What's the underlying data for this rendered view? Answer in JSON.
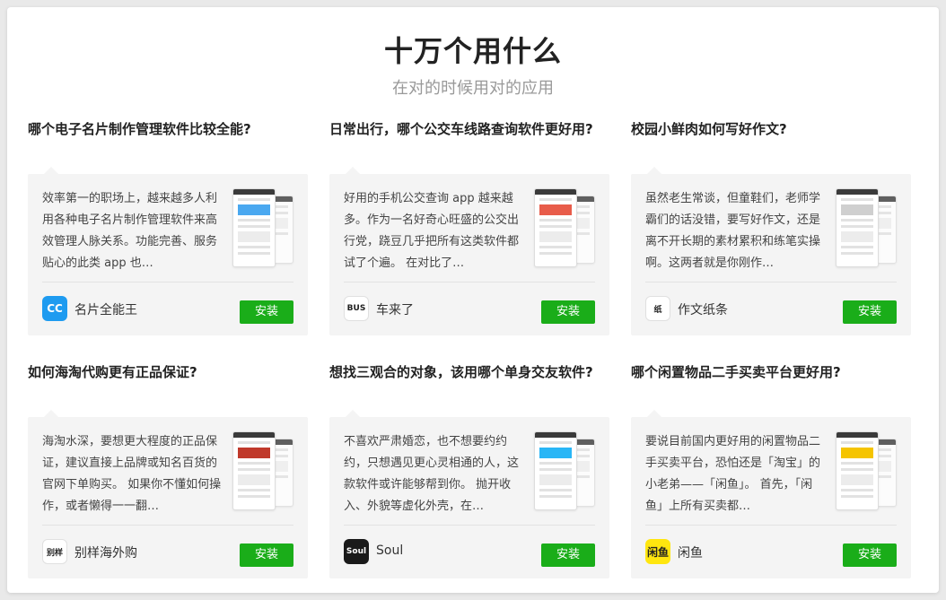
{
  "header": {
    "title": "十万个用什么",
    "subtitle": "在对的时候用对的应用"
  },
  "colors": {
    "install_green": "#1aad19",
    "card_bg": "#f4f4f4"
  },
  "cards": [
    {
      "question": "哪个电子名片制作管理软件比较全能?",
      "desc": "效率第一的职场上，越来越多人利用各种电子名片制作管理软件来高效管理人脉关系。功能完善、服务贴心的此类 app 也…",
      "app_name": "名片全能王",
      "icon_text": "CC",
      "icon_color": "#1e9bf0",
      "icon_name": "card-scanner-icon",
      "install": "安装"
    },
    {
      "question": "日常出行，哪个公交车线路查询软件更好用?",
      "desc": "好用的手机公交查询 app 越来越多。作为一名好奇心旺盛的公交出行党，跷豆几乎把所有这类软件都试了个遍。 在对比了…",
      "app_name": "车来了",
      "icon_text": "BUS",
      "icon_color": "#ffffff",
      "icon_name": "bus-pin-icon",
      "install": "安装"
    },
    {
      "question": "校园小鲜肉如何写好作文?",
      "desc": "虽然老生常谈，但童鞋们，老师学霸们的话没错，要写好作文，还是离不开长期的素材累积和练笔实操啊。这两者就是你刚作…",
      "app_name": "作文纸条",
      "icon_text": "纸",
      "icon_color": "#ffffff",
      "icon_name": "calligraphy-icon",
      "install": "安装"
    },
    {
      "question": "如何海淘代购更有正品保证?",
      "desc": "海淘水深，要想更大程度的正品保证，建议直接上品牌或知名百货的官网下单购买。 如果你不懂如何操作，或者懒得一一翻…",
      "app_name": "别样海外购",
      "icon_text": "别样",
      "icon_color": "#ffffff",
      "icon_name": "bieyang-logo-icon",
      "install": "安装"
    },
    {
      "question": "想找三观合的对象，该用哪个单身交友软件?",
      "desc": "不喜欢严肃婚恋，也不想要约约约，只想遇见更心灵相通的人，这款软件或许能够帮到你。 抛开收入、外貌等虚化外壳，在…",
      "app_name": "Soul",
      "icon_text": "Soul",
      "icon_color": "#1a1a1a",
      "icon_name": "soul-logo-icon",
      "install": "安装"
    },
    {
      "question": "哪个闲置物品二手买卖平台更好用?",
      "desc": "要说目前国内更好用的闲置物品二手买卖平台，恐怕还是「淘宝」的小老弟——「闲鱼」。 首先，「闲鱼」上所有买卖都…",
      "app_name": "闲鱼",
      "icon_text": "闲鱼",
      "icon_color": "#ffe60f",
      "icon_name": "xianyu-logo-icon",
      "install": "安装"
    }
  ]
}
